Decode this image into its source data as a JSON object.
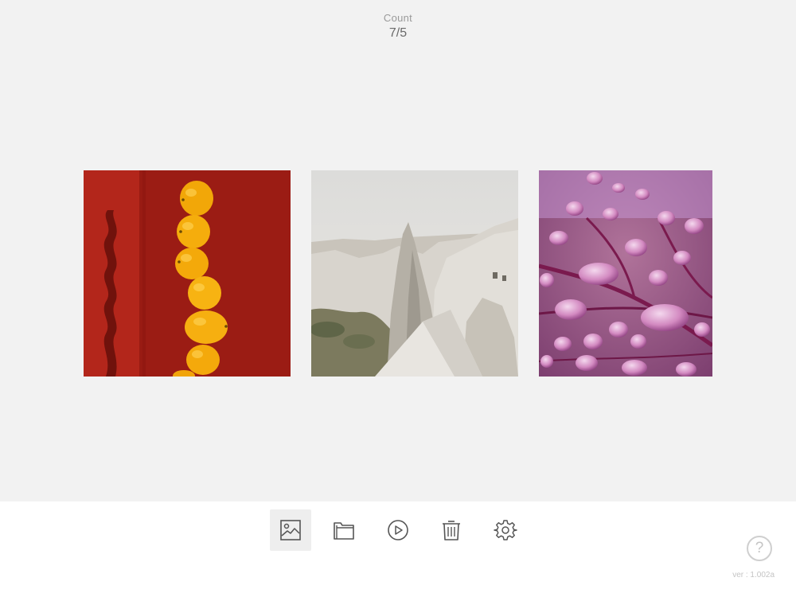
{
  "header": {
    "count_label": "Count",
    "count_value": "7/5"
  },
  "gallery": {
    "photos": [
      {
        "subject": "stack of lemons against red wall"
      },
      {
        "subject": "rocky landscape fairy chimneys"
      },
      {
        "subject": "water droplets on purple leaf"
      }
    ]
  },
  "toolbar": {
    "buttons": [
      {
        "icon": "image-icon",
        "active": true
      },
      {
        "icon": "folder-icon",
        "active": false
      },
      {
        "icon": "play-icon",
        "active": false
      },
      {
        "icon": "trash-icon",
        "active": false
      },
      {
        "icon": "gear-icon",
        "active": false
      }
    ],
    "icon_color": "#555555",
    "active_bg": "#eeeeee"
  },
  "help": {
    "label": "?"
  },
  "footer": {
    "version": "ver : 1.002a"
  }
}
